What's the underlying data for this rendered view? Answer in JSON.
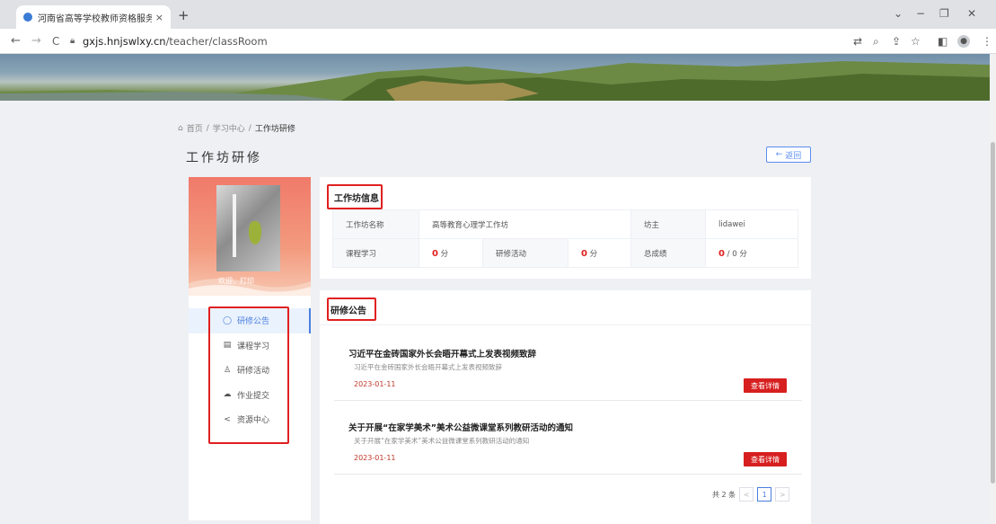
{
  "browser": {
    "tab_title": "河南省高等学校教师资格服务云平台",
    "tab_close": "×",
    "new_tab": "+",
    "url_host": "gxjs.hnjswlxy.cn",
    "url_path": "/teacher/classRoom",
    "controls": {
      "down": "⌄",
      "minimize": "−",
      "restore": "❐",
      "close": "✕"
    },
    "nav": {
      "back": "←",
      "forward": "→",
      "reload": "C"
    },
    "toolbar_icons": [
      "translate-icon",
      "zoom-icon",
      "share-icon",
      "bookmark-star-icon",
      "sidepanel-icon",
      "profile-icon",
      "menu-icon"
    ]
  },
  "breadcrumb": {
    "home": "首页",
    "sep": "/",
    "learning": "学习中心",
    "current": "工作坊研修"
  },
  "page": {
    "title": "工作坊研修",
    "back_button": "返回"
  },
  "sidebar": {
    "welcome": "欢迎，打印",
    "items": [
      {
        "label": "研修公告",
        "icon": "comment-icon",
        "glyph": "◯"
      },
      {
        "label": "课程学习",
        "icon": "book-icon",
        "glyph": "▤"
      },
      {
        "label": "研修活动",
        "icon": "activity-icon",
        "glyph": "♙"
      },
      {
        "label": "作业提交",
        "icon": "upload-cloud-icon",
        "glyph": "☁"
      },
      {
        "label": "资源中心",
        "icon": "share-nodes-icon",
        "glyph": "<"
      }
    ]
  },
  "workshop_info": {
    "heading": "工作坊信息",
    "name_label": "工作坊名称",
    "name_value": "高等教育心理学工作坊",
    "owner_label": "坊主",
    "owner_value": "lidawei",
    "course_label": "课程学习",
    "course_score": "0",
    "activity_label": "研修活动",
    "activity_score": "0",
    "total_label": "总成绩",
    "total_score": "0",
    "total_rest": "/ 0 分",
    "unit": "分"
  },
  "announcements": {
    "heading": "研修公告",
    "items": [
      {
        "title": "习近平在金砖国家外长会晤开幕式上发表视频致辞",
        "desc": "习近平在金砖国家外长会晤开幕式上发表视频致辞",
        "date": "2023-01-11",
        "button": "查看详情"
      },
      {
        "title": "关于开展“在家学美术”美术公益微课堂系列教研活动的通知",
        "desc": "关于开展“在家学美术”美术公益微课堂系列教研活动的通知",
        "date": "2023-01-11",
        "button": "查看详情"
      }
    ],
    "pager": {
      "total": "共 2 条",
      "prev": "<",
      "page": "1",
      "next": ">"
    }
  },
  "colors": {
    "accent": "#4a7fe0",
    "danger": "#d71f1f",
    "highlight_box": "#e02020"
  }
}
